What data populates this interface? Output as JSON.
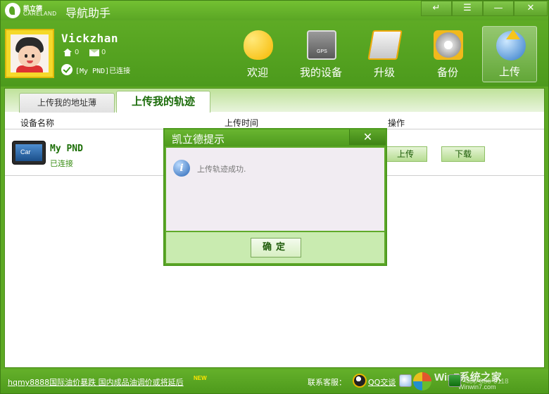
{
  "app": {
    "logo_cn": "凯立德",
    "logo_en": "CARELAND",
    "title": "导航助手",
    "window_buttons": [
      "↵",
      "☰",
      "—",
      "✕"
    ]
  },
  "profile": {
    "username": "Vickzhan",
    "home_count": "0",
    "mail_count": "0",
    "connection": "[My PND]已连接"
  },
  "nav": [
    {
      "label": "欢迎",
      "icon": "heart-icon"
    },
    {
      "label": "我的设备",
      "icon": "gps-device-icon"
    },
    {
      "label": "升级",
      "icon": "upgrade-icon"
    },
    {
      "label": "备份",
      "icon": "backup-disc-icon"
    },
    {
      "label": "上传",
      "icon": "upload-globe-icon",
      "active": true
    }
  ],
  "tabs": [
    {
      "label": "上传我的地址薄",
      "active": false
    },
    {
      "label": "上传我的轨迹",
      "active": true
    }
  ],
  "table": {
    "columns": [
      "设备名称",
      "上传时间",
      "操作"
    ],
    "rows": [
      {
        "device_icon_text": "Car",
        "name": "My PND",
        "status": "已连接",
        "upload_label": "上传",
        "download_label": "下载"
      }
    ]
  },
  "dialog": {
    "title": "凯立德提示",
    "close": "✕",
    "message": "上传轨迹成功.",
    "ok": "确定"
  },
  "statusbar": {
    "news": "hqmy8888国际油价暴跌 国内成品油调价或将延后",
    "new_badge": "NEW",
    "contact_label": "联系客服：",
    "qq_label": "QQ交谈",
    "watermark": "Win7系统之家",
    "watermark_url": "Winwin7.com",
    "phone": "400-886-0118"
  },
  "colors": {
    "frame_green": "#5da924",
    "accent_dark_green": "#1a6b08",
    "dialog_body": "#f1ecf2",
    "dialog_footer": "#c9ebb0"
  }
}
